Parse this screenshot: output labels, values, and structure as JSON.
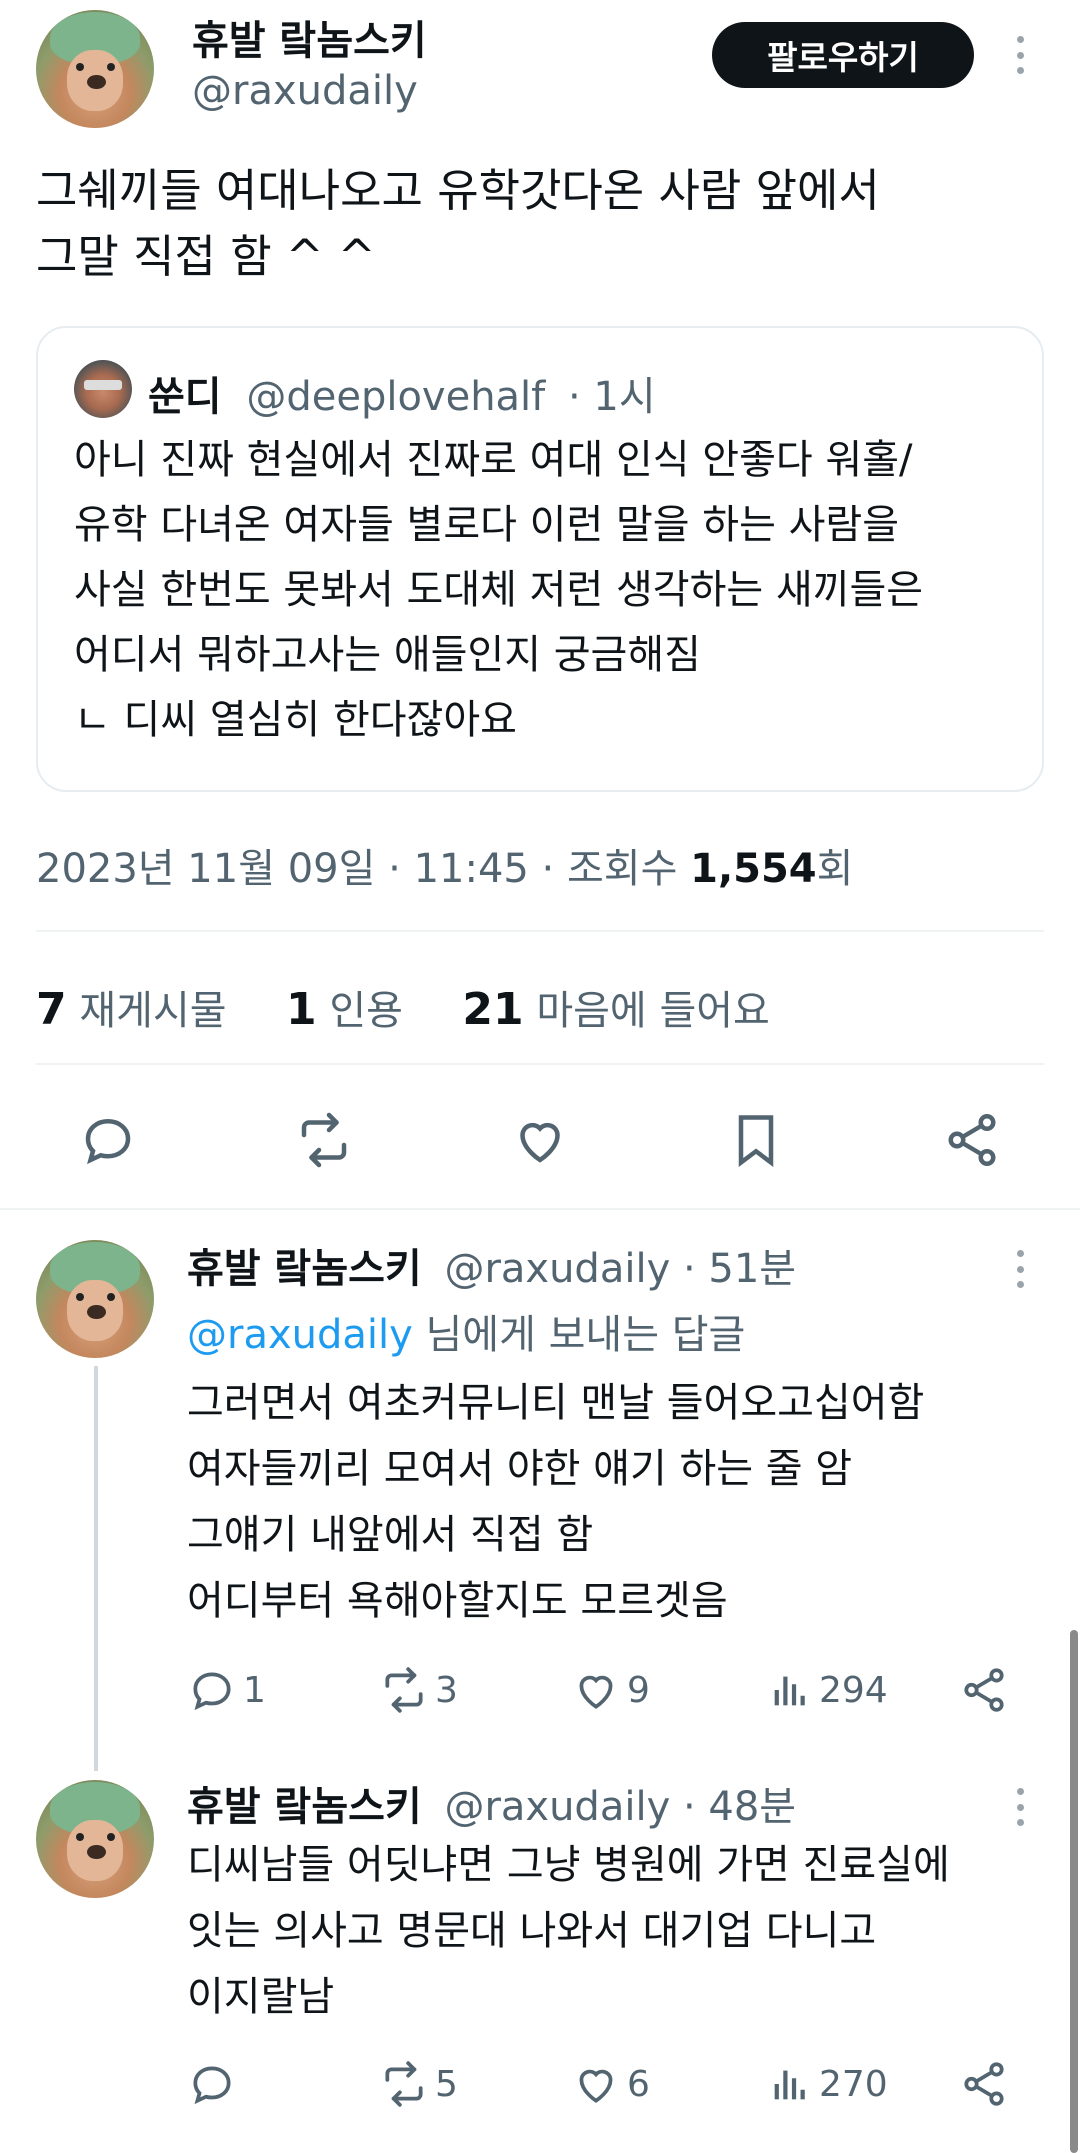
{
  "main_tweet": {
    "author_name": "휴발 랔놈스키",
    "author_handle": "@raxudaily",
    "follow_label": "팔로우하기",
    "text_lines": [
      "그쉐끼들 여대나오고 유학갓다온 사람 앞에서",
      "그말 직접 함 ^ ^"
    ],
    "quote": {
      "name": "쑨디",
      "handle": "@deeplovehalf",
      "time": "· 1시",
      "text_lines": [
        "아니 진짜 현실에서 진짜로 여대 인식 안좋다 워홀/",
        "유학 다녀온 여자들 별로다 이런 말을 하는 사람을",
        "사실 한번도 못봐서 도대체 저런 생각하는 새끼들은",
        "어디서 뭐하고사는 애들인지 궁금해짐",
        "ㄴ 디씨 열심히 한다잖아요"
      ]
    },
    "meta": {
      "datetime": "2023년 11월 09일 · 11:45 · 조회수 ",
      "views": "1,554",
      "views_suffix": "회"
    },
    "stats": {
      "reposts_count": "7",
      "reposts_label": "재게시물",
      "quotes_count": "1",
      "quotes_label": "인용",
      "likes_count": "21",
      "likes_label": "마음에 들어요"
    }
  },
  "replies": [
    {
      "name": "휴발 랔놈스키",
      "handle": "@raxudaily · 51분",
      "reply_to_mention": "@raxudaily",
      "reply_to_suffix": " 님에게 보내는 답글",
      "text_lines": [
        "그러면서 여초커뮤니티 맨날 들어오고십어함",
        "여자들끼리 모여서 야한 얘기 하는 줄 암",
        "그얘기 내앞에서 직접 함",
        "어디부터 욕해아할지도 모르겟음"
      ],
      "replies": "1",
      "reposts": "3",
      "likes": "9",
      "views": "294"
    },
    {
      "name": "휴발 랔놈스키",
      "handle": "@raxudaily · 48분",
      "text_lines": [
        "디씨남들 어딧냐면 그냥 병원에 가면 진료실에",
        "잇는 의사고 명문대 나와서 대기업 다니고",
        "이지랄남"
      ],
      "replies": "",
      "reposts": "5",
      "likes": "6",
      "views": "270"
    }
  ],
  "icons": {
    "reply": "reply-icon",
    "repost": "repost-icon",
    "like": "heart-icon",
    "bookmark": "bookmark-icon",
    "share": "share-icon",
    "views": "views-icon",
    "more": "more-icon"
  },
  "colors": {
    "text": "#0f1419",
    "secondary": "#536471",
    "link": "#1d9bf0",
    "button": "#0f1419"
  }
}
